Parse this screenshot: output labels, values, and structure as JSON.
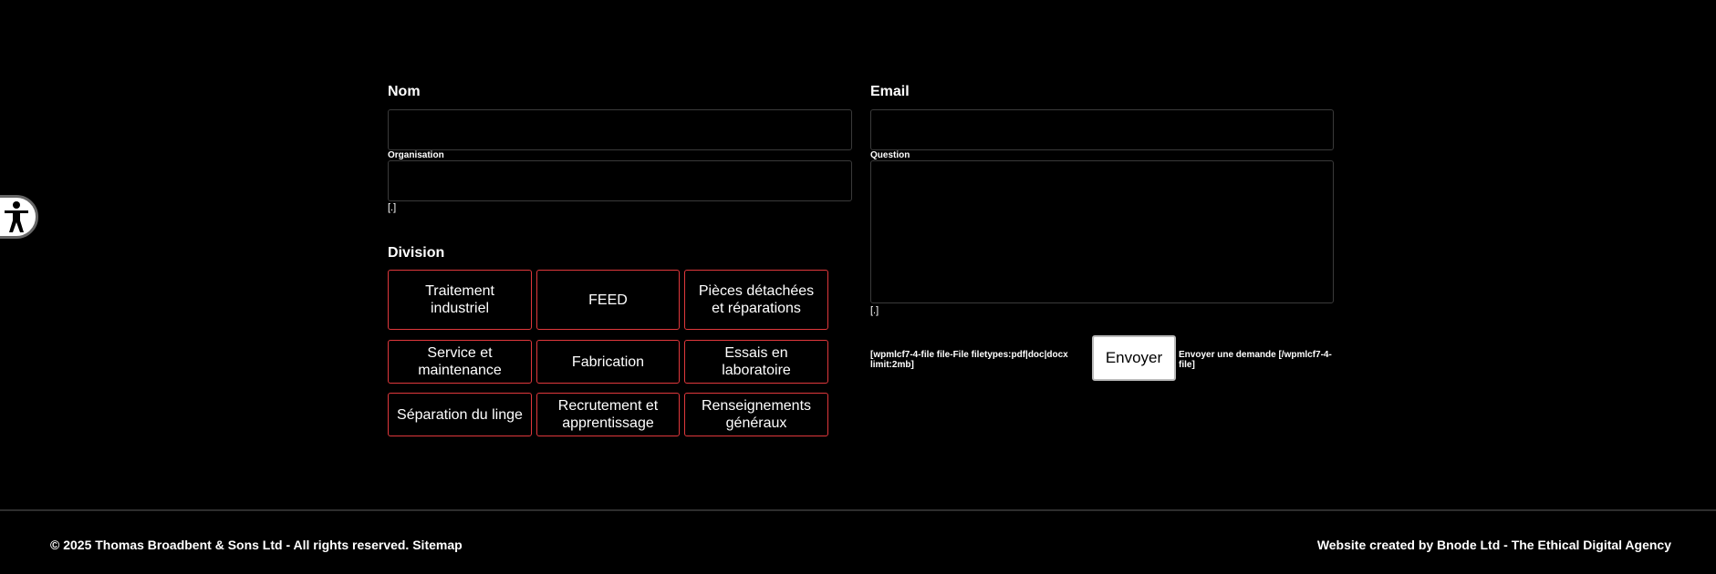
{
  "form": {
    "nom_label": "Nom",
    "email_label": "Email",
    "organisation_label": "Organisation",
    "question_label": "Question",
    "org_note": "[.]",
    "question_note": "[.]",
    "division_label": "Division",
    "divisions": [
      "Traitement industriel",
      "FEED",
      "Pièces détachées et réparations",
      "Service et maintenance",
      "Fabrication",
      "Essais en laboratoire",
      "Séparation du linge",
      "Recrutement et apprentissage",
      "Renseignements généraux"
    ],
    "file_shortcode": "[wpmlcf7-4-file file-File filetypes:pdf|doc|docx limit:2mb]",
    "submit_label": "Envoyer",
    "after_submit_text": "Envoyer une demande [/wpmlcf7-4-file]"
  },
  "footer": {
    "copyright": "© 2025 Thomas Broadbent & Sons Ltd - All rights reserved.",
    "sitemap_link": "Sitemap",
    "credit": "Website created by Bnode Ltd - The Ethical Digital Agency"
  }
}
